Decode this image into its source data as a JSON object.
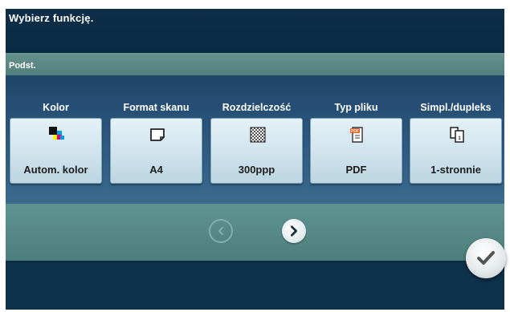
{
  "header": {
    "title": "Wybierz funkcję."
  },
  "tab": {
    "label": "Podst."
  },
  "functions": [
    {
      "label": "Kolor",
      "value": "Autom. kolor",
      "icon": "color-squares-icon"
    },
    {
      "label": "Format skanu",
      "value": "A4",
      "icon": "paper-size-icon"
    },
    {
      "label": "Rozdzielczość",
      "value": "300ppp",
      "icon": "resolution-grid-icon"
    },
    {
      "label": "Typ pliku",
      "value": "PDF",
      "icon": "pdf-file-icon"
    },
    {
      "label": "Simpl./dupleks",
      "value": "1-stronnie",
      "icon": "simplex-duplex-icon"
    }
  ],
  "pdf_badge": "PDF",
  "navigation": {
    "prev_icon": "chevron-left-icon",
    "next_icon": "chevron-right-icon"
  },
  "confirm": {
    "icon": "checkmark-icon"
  },
  "colors": {
    "header": "#0e2d46",
    "panel": "#2f5a82",
    "teal": "#5d8a88",
    "button": "#d4e7ef"
  }
}
